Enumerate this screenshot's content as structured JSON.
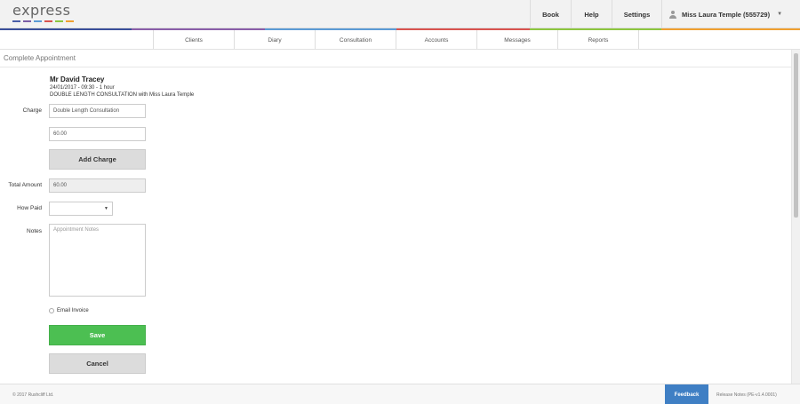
{
  "app": {
    "logo_text": "express",
    "logo_colors": [
      "#4a5ea8",
      "#7b5ea7",
      "#5b9bd5",
      "#d9534f",
      "#8dc63f",
      "#f0a030"
    ]
  },
  "topnav": {
    "book": "Book",
    "help": "Help",
    "settings": "Settings",
    "user": "Miss Laura Temple (555729)"
  },
  "strip_colors": [
    "#3a4f9a",
    "#8a5ea9",
    "#5b9bd5",
    "#d9534f",
    "#8dc63f",
    "#f0a030"
  ],
  "subnav": {
    "items": [
      {
        "label": "Clients"
      },
      {
        "label": "Diary"
      },
      {
        "label": "Consultation"
      },
      {
        "label": "Accounts"
      },
      {
        "label": "Messages"
      },
      {
        "label": "Reports"
      }
    ]
  },
  "page": {
    "title": "Complete Appointment"
  },
  "appointment": {
    "client": "Mr David Tracey",
    "datetime": "24/01/2017 - 09:30 - 1 hour",
    "description": "DOUBLE LENGTH CONSULTATION with Miss Laura Temple"
  },
  "form": {
    "charge_label": "Charge",
    "charge_value": "Double Length Consultation",
    "amount_value": "60.00",
    "add_charge_label": "Add Charge",
    "total_label": "Total Amount",
    "total_value": "60.00",
    "how_paid_label": "How Paid",
    "how_paid_value": "",
    "notes_label": "Notes",
    "notes_placeholder": "Appointment Notes",
    "email_invoice_label": "Email Invoice",
    "save_label": "Save",
    "cancel_label": "Cancel"
  },
  "footer": {
    "copyright": "© 2017 Rushcliff Ltd.",
    "feedback": "Feedback",
    "release_notes": "Release Notes (PE-v1.4.0001)"
  }
}
